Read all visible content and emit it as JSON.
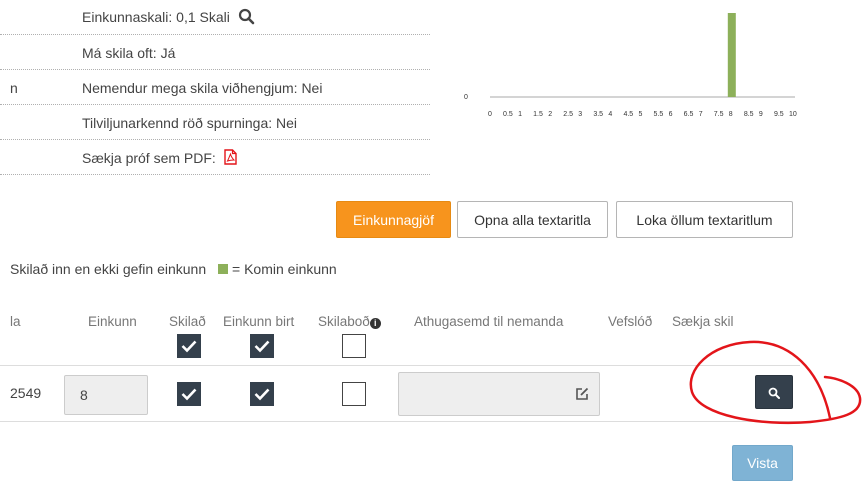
{
  "settings": {
    "grade_scale": "Einkunnaskali: 0,1 Skali",
    "submit_often": "Má skila oft: Já",
    "attachments": "Nemendur mega skila viðhengjum: Nei",
    "random_order": "Tilviljunarkennd röð spurninga: Nei",
    "pdf": "Sækja próf sem PDF:",
    "left_letter": "n"
  },
  "chart_data": {
    "type": "bar",
    "y_tick": "0",
    "x_ticks": [
      "0",
      "0.5",
      "1",
      "1.5",
      "2",
      "2.5",
      "3",
      "3.5",
      "4",
      "4.5",
      "5",
      "5.5",
      "6",
      "6.5",
      "7",
      "7.5",
      "8",
      "8.5",
      "9",
      "9.5",
      "10"
    ],
    "x": [
      8
    ],
    "values": [
      1
    ],
    "color": "#8db05a"
  },
  "toolbar": {
    "grading_label": "Einkunnagjöf",
    "open_all_label": "Opna alla textaritla",
    "close_all_label": "Loka öllum textaritlum"
  },
  "legend": {
    "text": "Skilað inn en ekki gefin einkunn",
    "came_label": "= Komin einkunn",
    "came_color": "#8db05a"
  },
  "table": {
    "headers": {
      "first": "la",
      "grade": "Einkunn",
      "submitted": "Skilað",
      "grade_published": "Einkunn birt",
      "messages": "Skilaboð",
      "comment": "Athugasemd til nemanda",
      "web_link": "Vefslóð",
      "fetch": "Sækja skil"
    },
    "row": {
      "id": "2549",
      "grade": "8",
      "submitted": true,
      "published": true,
      "message": false
    }
  },
  "footer": {
    "view_label": "Vista"
  },
  "colors": {
    "orange": "#f7941d",
    "dark": "#34404c",
    "blue": "#7fb3d5",
    "annotation": "#e3151a"
  }
}
